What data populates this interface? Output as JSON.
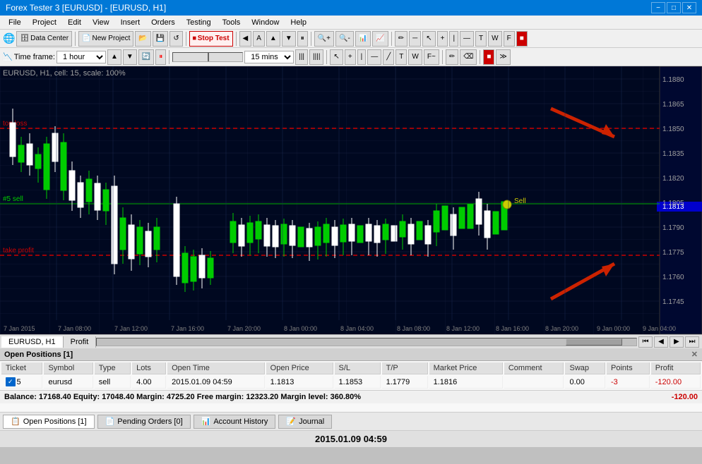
{
  "titleBar": {
    "title": "Forex Tester 3 [EURUSD] - [EURUSD, H1]",
    "minBtn": "−",
    "maxBtn": "□",
    "closeBtn": "✕"
  },
  "menuBar": {
    "items": [
      "File",
      "Project",
      "Edit",
      "View",
      "Insert",
      "Orders",
      "Testing",
      "Tools",
      "Window",
      "Help"
    ]
  },
  "toolbar1": {
    "dataCenterLabel": "Data Center",
    "newProjectLabel": "New Project",
    "stopTestLabel": "Stop Test"
  },
  "toolbar2": {
    "timeframeLabel": "Time frame:",
    "timeframeValue": "1 hour",
    "speedValue": "15 mins"
  },
  "chart": {
    "info": "EURUSD, H1, cell: 15, scale: 100%",
    "stopLossLabel": "top loss",
    "takeProfitLabel": "take profit",
    "sellLabel": "#5 sell",
    "sellMarkerLabel": "Sell",
    "prices": {
      "p1880": "1.1880",
      "p1865": "1.1865",
      "p1850": "1.1850",
      "p1835": "1.1835",
      "p1820": "1.1820",
      "p1813": "1.1813",
      "p1805": "1.1805",
      "p1790": "1.1790",
      "p1775": "1.1775",
      "p1760": "1.1760",
      "p1745": "1.1745"
    },
    "dates": [
      "7 Jan 2015",
      "7 Jan 08:00",
      "7 Jan 12:00",
      "7 Jan 16:00",
      "7 Jan 20:00",
      "8 Jan 00:00",
      "8 Jan 04:00",
      "8 Jan 08:00",
      "8 Jan 12:00",
      "8 Jan 16:00",
      "8 Jan 20:00",
      "9 Jan 00:00",
      "9 Jan 04:00"
    ]
  },
  "bottomTabs": {
    "tab1": "EURUSD, H1",
    "tab2": "Profit",
    "navFirst": "⏮",
    "navPrev": "◀",
    "navPlay": "▶",
    "navFast": "⏭"
  },
  "positionsPanel": {
    "header": "Open Positions [1]",
    "columns": [
      "Ticket",
      "Symbol",
      "Type",
      "Lots",
      "Open Time",
      "Open Price",
      "S/L",
      "T/P",
      "Market Price",
      "Comment",
      "Swap",
      "Points",
      "Profit"
    ],
    "rows": [
      {
        "ticket": "5",
        "symbol": "eurusd",
        "type": "sell",
        "lots": "4.00",
        "openTime": "2015.01.09 04:59",
        "openPrice": "1.1813",
        "sl": "1.1853",
        "tp": "1.1779",
        "marketPrice": "1.1816",
        "comment": "",
        "swap": "0.00",
        "points": "-3",
        "profit": "-120.00"
      }
    ],
    "balance": "Balance: 17168.40  Equity: 17048.40  Margin: 4725.20  Free margin: 12323.20  Margin level: 360.80%",
    "totalProfit": "-120.00"
  },
  "footerTabs": {
    "tab1": "Open Positions [1]",
    "tab2": "Pending Orders [0]",
    "tab3": "Account History",
    "tab4": "Journal"
  },
  "dateDisplay": "2015.01.09 04:59"
}
